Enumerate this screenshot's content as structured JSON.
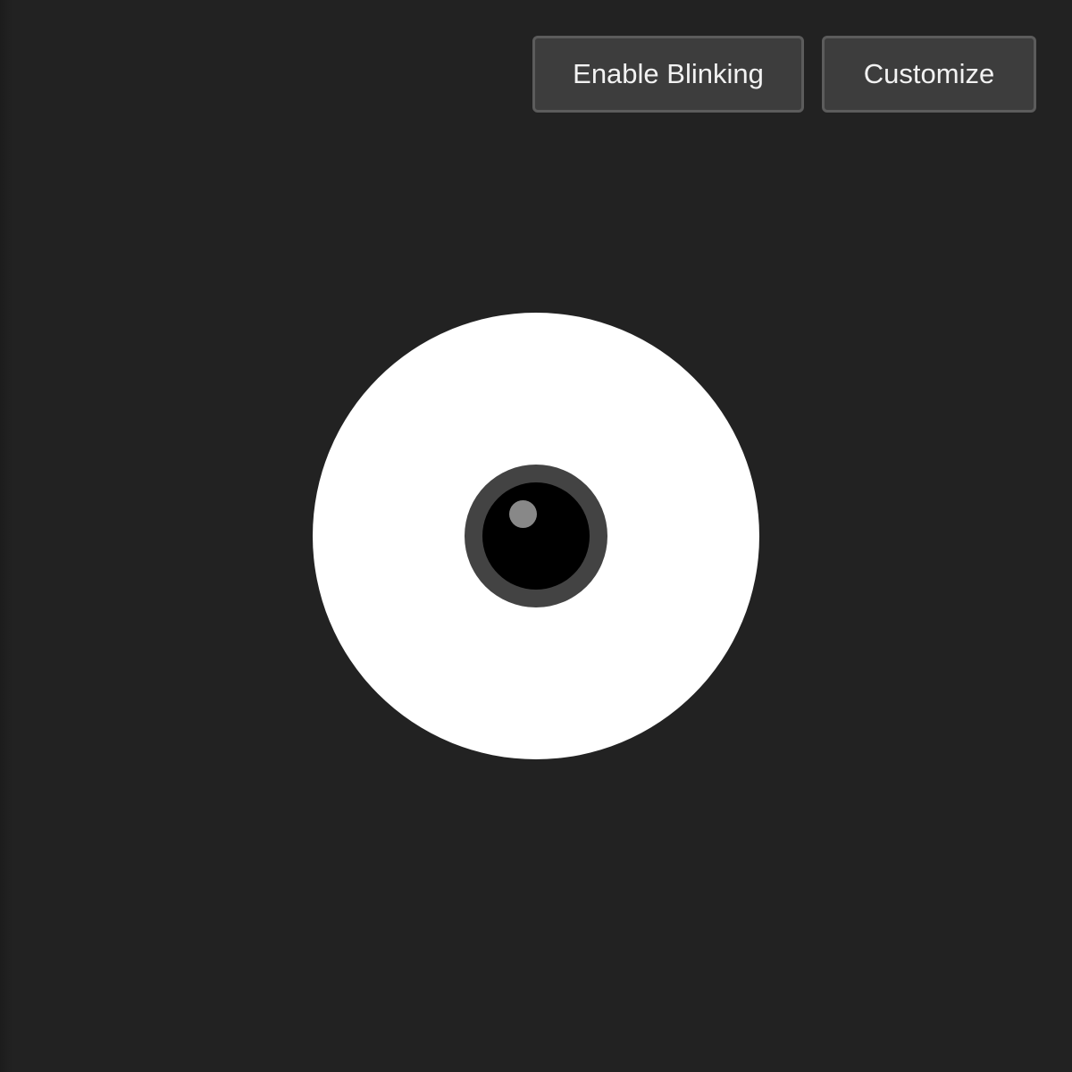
{
  "toolbar": {
    "blink_label": "Enable Blinking",
    "customize_label": "Customize"
  },
  "eye": {
    "sclera_color": "#ffffff",
    "iris_color": "#434343",
    "pupil_color": "#000000",
    "glint_color": "#888888"
  },
  "colors": {
    "background": "#222222",
    "button_bg": "#3d3d3d",
    "button_border": "#5c5c5c"
  }
}
